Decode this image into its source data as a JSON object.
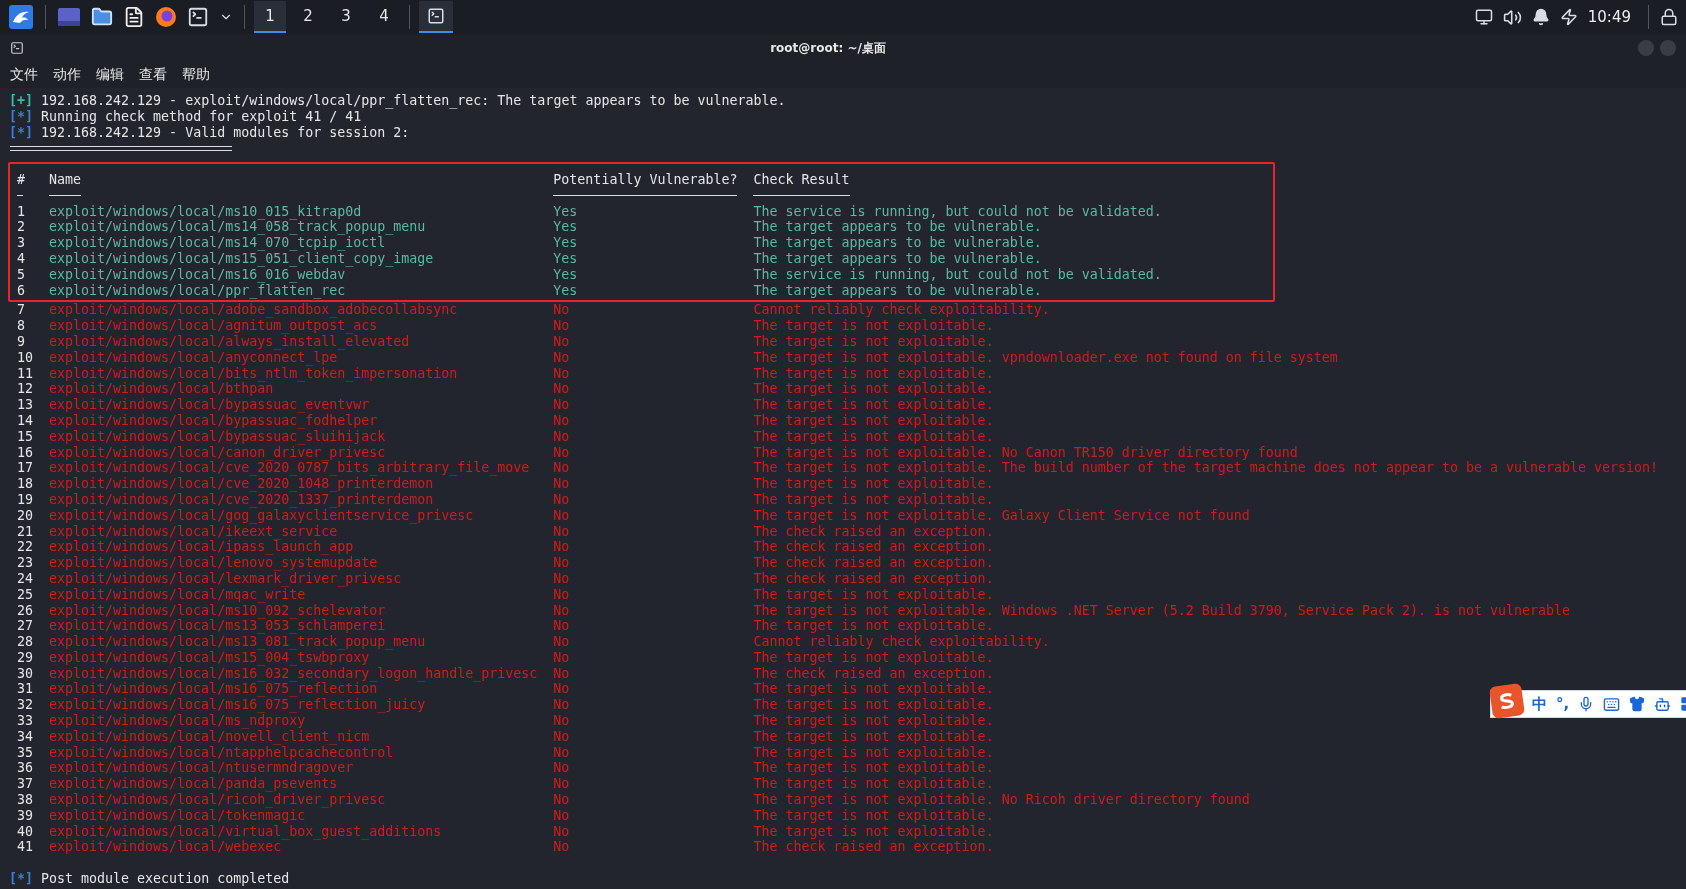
{
  "taskbar": {
    "workspaces": [
      {
        "label": "1",
        "selected": true
      },
      {
        "label": "2",
        "selected": false
      },
      {
        "label": "3",
        "selected": false
      },
      {
        "label": "4",
        "selected": false
      }
    ],
    "clock": "10:49"
  },
  "window": {
    "title": "root@root: ~/桌面"
  },
  "menu": [
    "文件",
    "动作",
    "编辑",
    "查看",
    "帮助"
  ],
  "terminal": {
    "lines_before": [
      {
        "kind": "success",
        "marker": "[+]",
        "text": "192.168.242.129 - exploit/windows/local/ppr_flatten_rec: The target appears to be vulnerable."
      },
      {
        "kind": "info",
        "marker": "[*]",
        "text": "Running check method for exploit 41 / 41"
      },
      {
        "kind": "info",
        "marker": "[*]",
        "text": "192.168.242.129 - Valid modules for session 2:"
      }
    ],
    "table": {
      "boxed": true,
      "columns": [
        "#",
        "Name",
        "Potentially Vulnerable?",
        "Check Result"
      ],
      "rows": [
        {
          "kind": "vulnerable",
          "num": "1",
          "name": "exploit/windows/local/ms10_015_kitrap0d",
          "vulnerable": "Yes",
          "result": "The service is running, but could not be validated."
        },
        {
          "kind": "vulnerable",
          "num": "2",
          "name": "exploit/windows/local/ms14_058_track_popup_menu",
          "vulnerable": "Yes",
          "result": "The target appears to be vulnerable."
        },
        {
          "kind": "vulnerable",
          "num": "3",
          "name": "exploit/windows/local/ms14_070_tcpip_ioctl",
          "vulnerable": "Yes",
          "result": "The target appears to be vulnerable."
        },
        {
          "kind": "vulnerable",
          "num": "4",
          "name": "exploit/windows/local/ms15_051_client_copy_image",
          "vulnerable": "Yes",
          "result": "The target appears to be vulnerable."
        },
        {
          "kind": "vulnerable",
          "num": "5",
          "name": "exploit/windows/local/ms16_016_webdav",
          "vulnerable": "Yes",
          "result": "The service is running, but could not be validated."
        },
        {
          "kind": "vulnerable",
          "num": "6",
          "name": "exploit/windows/local/ppr_flatten_rec",
          "vulnerable": "Yes",
          "result": "The target appears to be vulnerable."
        },
        {
          "kind": "safe",
          "num": "7",
          "name": "exploit/windows/local/adobe_sandbox_adobecollabsync",
          "vulnerable": "No",
          "result": "Cannot reliably check exploitability."
        },
        {
          "kind": "safe",
          "num": "8",
          "name": "exploit/windows/local/agnitum_outpost_acs",
          "vulnerable": "No",
          "result": "The target is not exploitable."
        },
        {
          "kind": "safe",
          "num": "9",
          "name": "exploit/windows/local/always_install_elevated",
          "vulnerable": "No",
          "result": "The target is not exploitable."
        },
        {
          "kind": "safe",
          "num": "10",
          "name": "exploit/windows/local/anyconnect_lpe",
          "vulnerable": "No",
          "result": "The target is not exploitable. vpndownloader.exe not found on file system"
        },
        {
          "kind": "safe",
          "num": "11",
          "name": "exploit/windows/local/bits_ntlm_token_impersonation",
          "vulnerable": "No",
          "result": "The target is not exploitable."
        },
        {
          "kind": "safe",
          "num": "12",
          "name": "exploit/windows/local/bthpan",
          "vulnerable": "No",
          "result": "The target is not exploitable."
        },
        {
          "kind": "safe",
          "num": "13",
          "name": "exploit/windows/local/bypassuac_eventvwr",
          "vulnerable": "No",
          "result": "The target is not exploitable."
        },
        {
          "kind": "safe",
          "num": "14",
          "name": "exploit/windows/local/bypassuac_fodhelper",
          "vulnerable": "No",
          "result": "The target is not exploitable."
        },
        {
          "kind": "safe",
          "num": "15",
          "name": "exploit/windows/local/bypassuac_sluihijack",
          "vulnerable": "No",
          "result": "The target is not exploitable."
        },
        {
          "kind": "safe",
          "num": "16",
          "name": "exploit/windows/local/canon_driver_privesc",
          "vulnerable": "No",
          "result": "The target is not exploitable. No Canon TR150 driver directory found"
        },
        {
          "kind": "safe",
          "num": "17",
          "name": "exploit/windows/local/cve_2020_0787_bits_arbitrary_file_move",
          "vulnerable": "No",
          "result": "The target is not exploitable. The build number of the target machine does not appear to be a vulnerable version!"
        },
        {
          "kind": "safe",
          "num": "18",
          "name": "exploit/windows/local/cve_2020_1048_printerdemon",
          "vulnerable": "No",
          "result": "The target is not exploitable."
        },
        {
          "kind": "safe",
          "num": "19",
          "name": "exploit/windows/local/cve_2020_1337_printerdemon",
          "vulnerable": "No",
          "result": "The target is not exploitable."
        },
        {
          "kind": "safe",
          "num": "20",
          "name": "exploit/windows/local/gog_galaxyclientservice_privesc",
          "vulnerable": "No",
          "result": "The target is not exploitable. Galaxy Client Service not found"
        },
        {
          "kind": "safe",
          "num": "21",
          "name": "exploit/windows/local/ikeext_service",
          "vulnerable": "No",
          "result": "The check raised an exception."
        },
        {
          "kind": "safe",
          "num": "22",
          "name": "exploit/windows/local/ipass_launch_app",
          "vulnerable": "No",
          "result": "The check raised an exception."
        },
        {
          "kind": "safe",
          "num": "23",
          "name": "exploit/windows/local/lenovo_systemupdate",
          "vulnerable": "No",
          "result": "The check raised an exception."
        },
        {
          "kind": "safe",
          "num": "24",
          "name": "exploit/windows/local/lexmark_driver_privesc",
          "vulnerable": "No",
          "result": "The check raised an exception."
        },
        {
          "kind": "safe",
          "num": "25",
          "name": "exploit/windows/local/mqac_write",
          "vulnerable": "No",
          "result": "The target is not exploitable."
        },
        {
          "kind": "safe",
          "num": "26",
          "name": "exploit/windows/local/ms10_092_schelevator",
          "vulnerable": "No",
          "result": "The target is not exploitable. Windows .NET Server (5.2 Build 3790, Service Pack 2). is not vulnerable"
        },
        {
          "kind": "safe",
          "num": "27",
          "name": "exploit/windows/local/ms13_053_schlamperei",
          "vulnerable": "No",
          "result": "The target is not exploitable."
        },
        {
          "kind": "safe",
          "num": "28",
          "name": "exploit/windows/local/ms13_081_track_popup_menu",
          "vulnerable": "No",
          "result": "Cannot reliably check exploitability."
        },
        {
          "kind": "safe",
          "num": "29",
          "name": "exploit/windows/local/ms15_004_tswbproxy",
          "vulnerable": "No",
          "result": "The target is not exploitable."
        },
        {
          "kind": "safe",
          "num": "30",
          "name": "exploit/windows/local/ms16_032_secondary_logon_handle_privesc",
          "vulnerable": "No",
          "result": "The check raised an exception."
        },
        {
          "kind": "safe",
          "num": "31",
          "name": "exploit/windows/local/ms16_075_reflection",
          "vulnerable": "No",
          "result": "The target is not exploitable."
        },
        {
          "kind": "safe",
          "num": "32",
          "name": "exploit/windows/local/ms16_075_reflection_juicy",
          "vulnerable": "No",
          "result": "The target is not exploitable."
        },
        {
          "kind": "safe",
          "num": "33",
          "name": "exploit/windows/local/ms_ndproxy",
          "vulnerable": "No",
          "result": "The target is not exploitable."
        },
        {
          "kind": "safe",
          "num": "34",
          "name": "exploit/windows/local/novell_client_nicm",
          "vulnerable": "No",
          "result": "The target is not exploitable."
        },
        {
          "kind": "safe",
          "num": "35",
          "name": "exploit/windows/local/ntapphelpcachecontrol",
          "vulnerable": "No",
          "result": "The target is not exploitable."
        },
        {
          "kind": "safe",
          "num": "36",
          "name": "exploit/windows/local/ntusermndragover",
          "vulnerable": "No",
          "result": "The target is not exploitable."
        },
        {
          "kind": "safe",
          "num": "37",
          "name": "exploit/windows/local/panda_psevents",
          "vulnerable": "No",
          "result": "The target is not exploitable."
        },
        {
          "kind": "safe",
          "num": "38",
          "name": "exploit/windows/local/ricoh_driver_privesc",
          "vulnerable": "No",
          "result": "The target is not exploitable. No Ricoh driver directory found"
        },
        {
          "kind": "safe",
          "num": "39",
          "name": "exploit/windows/local/tokenmagic",
          "vulnerable": "No",
          "result": "The target is not exploitable."
        },
        {
          "kind": "safe",
          "num": "40",
          "name": "exploit/windows/local/virtual_box_guest_additions",
          "vulnerable": "No",
          "result": "The target is not exploitable."
        },
        {
          "kind": "safe",
          "num": "41",
          "name": "exploit/windows/local/webexec",
          "vulnerable": "No",
          "result": "The check raised an exception."
        }
      ]
    },
    "lines_after": [
      {
        "kind": "info",
        "marker": "[*]",
        "text": "Post module execution completed"
      }
    ]
  },
  "ime": {
    "mode": "中",
    "punct": "°,"
  }
}
